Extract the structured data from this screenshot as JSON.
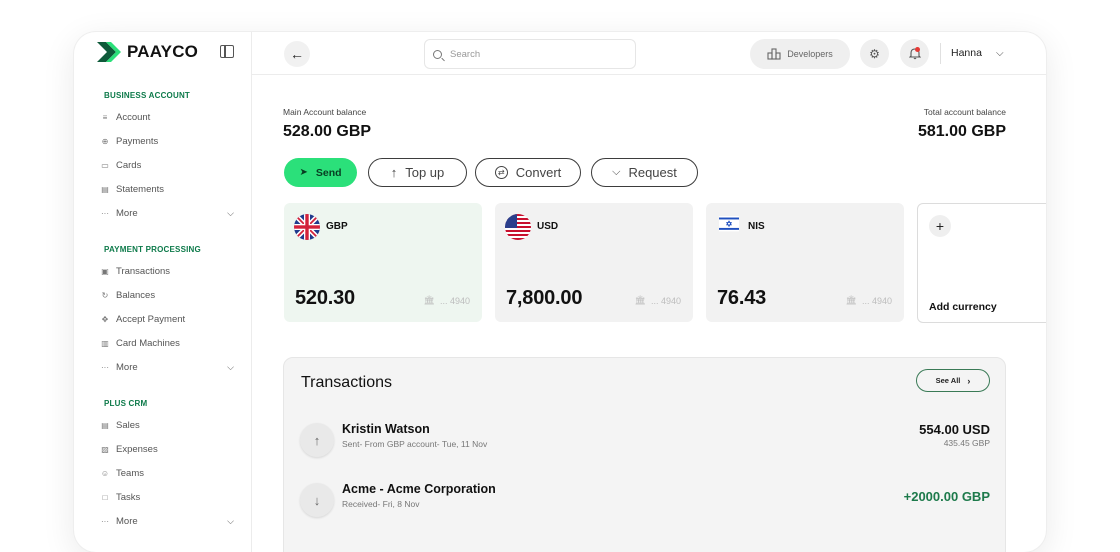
{
  "brand": {
    "name": "PAAYCO",
    "accent": "#2be07a",
    "logo_color": "#0f5a3a"
  },
  "sidebar": {
    "sections": [
      {
        "title": "BUSINESS ACCOUNT",
        "items": [
          {
            "label": "Account",
            "icon": "chart-icon"
          },
          {
            "label": "Payments",
            "icon": "globe-icon"
          },
          {
            "label": "Cards",
            "icon": "card-icon"
          },
          {
            "label": "Statements",
            "icon": "document-icon"
          },
          {
            "label": "More",
            "icon": "dots-icon"
          }
        ]
      },
      {
        "title": "PAYMENT PROCESSING",
        "items": [
          {
            "label": "Transactions",
            "icon": "cash-icon"
          },
          {
            "label": "Balances",
            "icon": "refresh-icon"
          },
          {
            "label": "Accept Payment",
            "icon": "move-icon"
          },
          {
            "label": "Card Machines",
            "icon": "terminal-icon"
          },
          {
            "label": "More",
            "icon": "dots-icon"
          }
        ]
      },
      {
        "title": "PLUS CRM",
        "items": [
          {
            "label": "Sales",
            "icon": "receipt-icon"
          },
          {
            "label": "Expenses",
            "icon": "expense-icon"
          },
          {
            "label": "Teams",
            "icon": "people-icon"
          },
          {
            "label": "Tasks",
            "icon": "task-icon"
          },
          {
            "label": "More",
            "icon": "dots-icon"
          }
        ]
      }
    ]
  },
  "header": {
    "search_placeholder": "Search",
    "developers_label": "Developers",
    "user_name": "Hanna"
  },
  "balances": {
    "main_label": "Main Account balance",
    "main_value": "528.00 GBP",
    "total_label": "Total account balance",
    "total_value": "581.00 GBP"
  },
  "actions": {
    "send": "Send",
    "top_up": "Top up",
    "convert": "Convert",
    "request": "Request"
  },
  "currency_cards": [
    {
      "code": "GBP",
      "amount": "520.30",
      "account": "... 4940",
      "flag": "uk-flag-icon"
    },
    {
      "code": "USD",
      "amount": "7,800.00",
      "account": "... 4940",
      "flag": "us-flag-icon"
    },
    {
      "code": "NIS",
      "amount": "76.43",
      "account": "... 4940",
      "flag": "israel-flag-icon"
    }
  ],
  "add_currency_label": "Add currency",
  "transactions": {
    "title": "Transactions",
    "see_all": "See All",
    "rows": [
      {
        "name": "Kristin Watson",
        "sub": "Sent- From GBP account- Tue, 11 Nov",
        "amount": "554.00 USD",
        "amount2": "435.45 GBP",
        "direction": "up"
      },
      {
        "name": "Acme - Acme Corporation",
        "sub": "Received- Fri, 8 Nov",
        "amount": "+2000.00 GBP",
        "amount2": "",
        "direction": "down"
      }
    ]
  }
}
